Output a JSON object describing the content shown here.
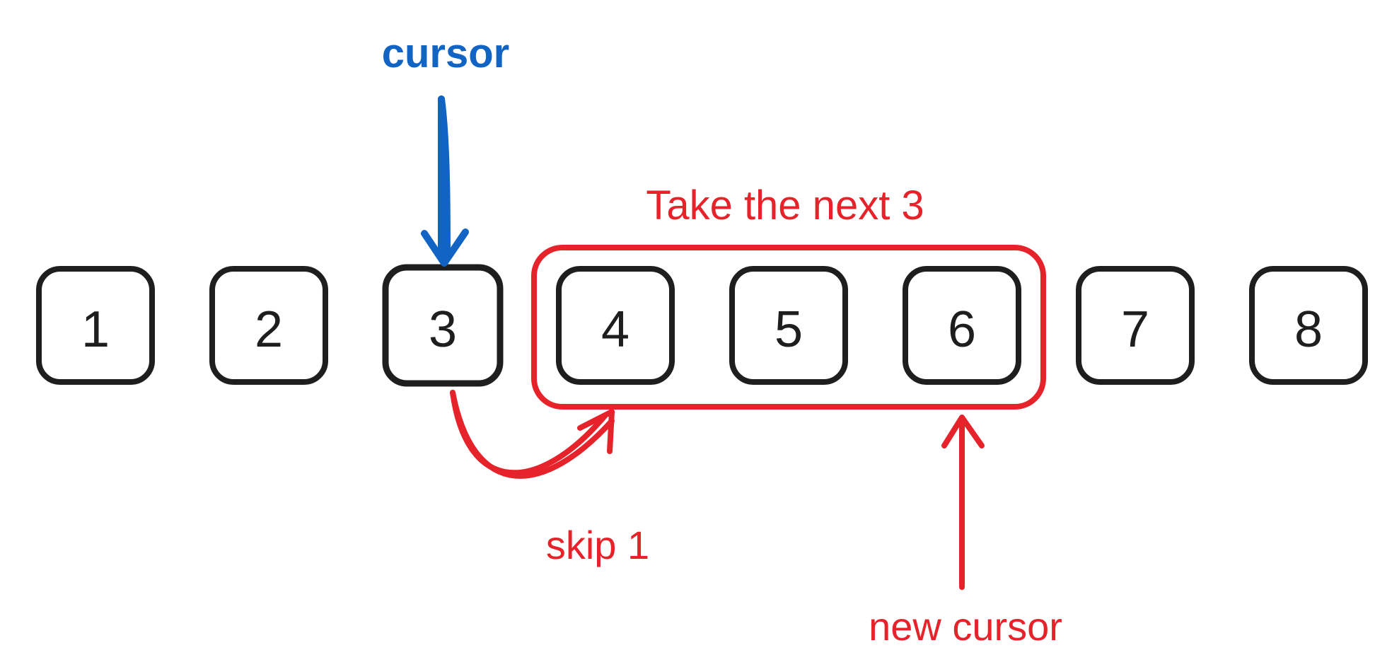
{
  "labels": {
    "cursor": "cursor",
    "take_next": "Take the next 3",
    "skip": "skip 1",
    "new_cursor": "new cursor"
  },
  "boxes": {
    "b1": "1",
    "b2": "2",
    "b3": "3",
    "b4": "4",
    "b5": "5",
    "b6": "6",
    "b7": "7",
    "b8": "8"
  },
  "colors": {
    "black": "#1e1e1e",
    "blue": "#1163c4",
    "red": "#e6232a"
  },
  "diagram": {
    "cursor_index": 3,
    "skip_count": 1,
    "take_count": 3,
    "selected_range": [
      4,
      6
    ],
    "new_cursor_index": 6,
    "total_items": 8
  }
}
